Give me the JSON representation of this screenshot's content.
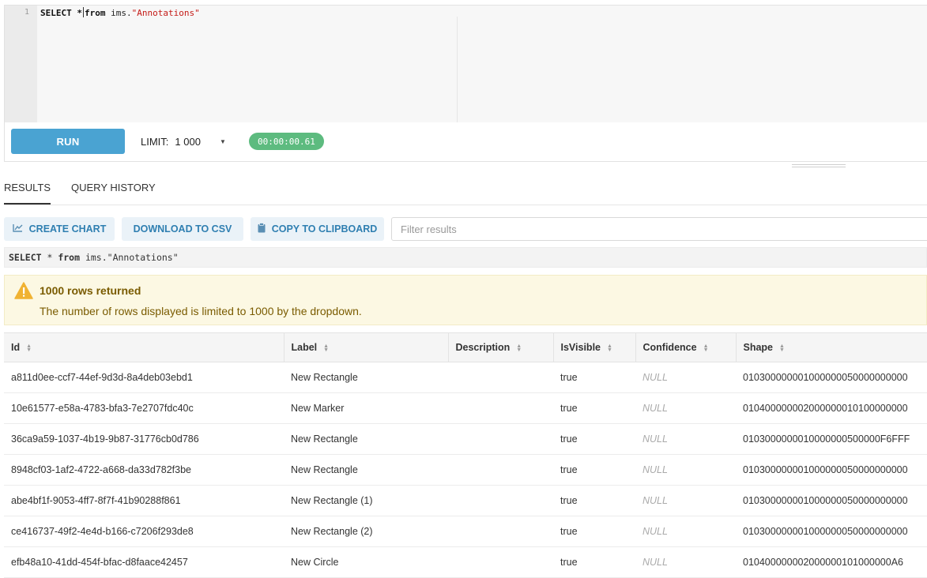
{
  "editor": {
    "line_number": "1",
    "code_select": "SELECT *",
    "code_from": "from",
    "code_schema": " ims.",
    "code_table": "\"Annotations\""
  },
  "toolbar": {
    "run_label": "RUN",
    "limit_label": "LIMIT:",
    "limit_value": "1 000",
    "elapsed": "00:00:00.61"
  },
  "tabs": [
    {
      "label": "RESULTS",
      "active": true
    },
    {
      "label": "QUERY HISTORY",
      "active": false
    }
  ],
  "actions": {
    "create_chart": "CREATE CHART",
    "download_csv": "DOWNLOAD TO CSV",
    "copy_clipboard": "COPY TO CLIPBOARD",
    "filter_placeholder": "Filter results"
  },
  "query_echo": {
    "select": "SELECT",
    "star": " * ",
    "from": "from",
    "rest": " ims.\"Annotations\""
  },
  "warning": {
    "title": "1000 rows returned",
    "message": "The number of rows displayed is limited to 1000 by the dropdown.",
    "color": "#fcf8e3"
  },
  "table": {
    "columns": [
      "Id",
      "Label",
      "Description",
      "IsVisible",
      "Confidence",
      "Shape"
    ],
    "rows": [
      [
        "a811d0ee-ccf7-44ef-9d3d-8a4deb03ebd1",
        "New Rectangle",
        "",
        "true",
        "NULL",
        "010300000001000000050000000000"
      ],
      [
        "10e61577-e58a-4783-bfa3-7e2707fdc40c",
        "New Marker",
        "",
        "true",
        "NULL",
        "010400000002000000010100000000"
      ],
      [
        "36ca9a59-1037-4b19-9b87-31776cb0d786",
        "New Rectangle",
        "",
        "true",
        "NULL",
        "0103000000010000000500000F6FFF"
      ],
      [
        "8948cf03-1af2-4722-a668-da33d782f3be",
        "New Rectangle",
        "",
        "true",
        "NULL",
        "010300000001000000050000000000"
      ],
      [
        "abe4bf1f-9053-4ff7-8f7f-41b90288f861",
        "New Rectangle (1)",
        "",
        "true",
        "NULL",
        "010300000001000000050000000000"
      ],
      [
        "ce416737-49f2-4e4d-b166-c7206f293de8",
        "New Rectangle (2)",
        "",
        "true",
        "NULL",
        "010300000001000000050000000000"
      ],
      [
        "efb48a10-41dd-454f-bfac-d8faace42457",
        "New Circle",
        "",
        "true",
        "NULL",
        "010400000002000000101000000A6"
      ]
    ]
  },
  "colors": {
    "run_button": "#4aa3d2",
    "timer_badge": "#5dbb7f",
    "action_button_bg": "#eaf2f8",
    "action_button_text": "#2f7fb1"
  }
}
